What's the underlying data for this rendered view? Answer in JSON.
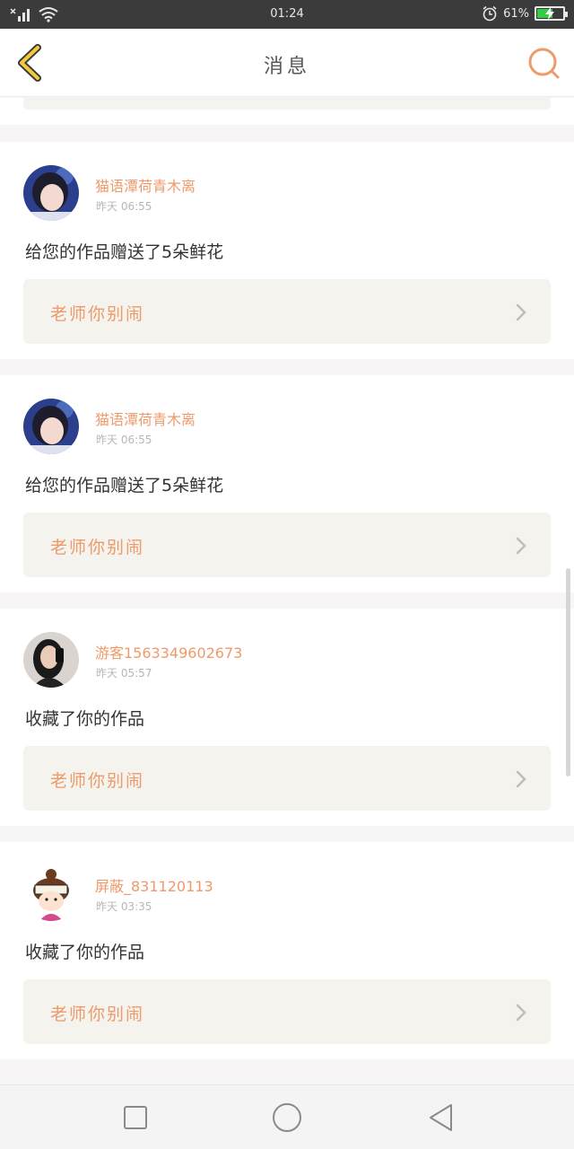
{
  "status_bar": {
    "time": "01:24",
    "battery_percent": "61%",
    "battery_level": 0.61
  },
  "header": {
    "title": "消息",
    "back_icon": "chevron-left-icon",
    "search_icon": "search-icon"
  },
  "messages": [
    {
      "username": "猫语潭荷青木离",
      "time": "昨天 06:55",
      "text": "给您的作品赠送了5朵鲜花",
      "work_title": "老师你别闹",
      "avatar_icon": "avatar-girl-blue"
    },
    {
      "username": "猫语潭荷青木离",
      "time": "昨天 06:55",
      "text": "给您的作品赠送了5朵鲜花",
      "work_title": "老师你别闹",
      "avatar_icon": "avatar-girl-blue"
    },
    {
      "username": "游客1563349602673",
      "time": "昨天 05:57",
      "text": "收藏了你的作品",
      "work_title": "老师你别闹",
      "avatar_icon": "avatar-girl-phone"
    },
    {
      "username": "屏蔽_831120113",
      "time": "昨天 03:35",
      "text": "收藏了你的作品",
      "work_title": "老师你别闹",
      "avatar_icon": "avatar-cartoon"
    }
  ],
  "colors": {
    "accent": "#ef9a6a",
    "card_bg": "#ffffff",
    "work_box_bg": "#f4f3ee",
    "page_bg": "#f7f5f5"
  }
}
